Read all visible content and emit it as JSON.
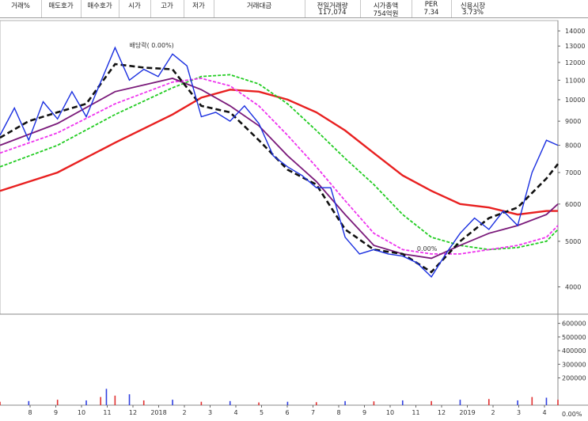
{
  "header": {
    "columns": [
      {
        "label": "거래%",
        "value": ""
      },
      {
        "label": "매도호가",
        "value": ""
      },
      {
        "label": "매수호가",
        "value": ""
      },
      {
        "label": "시가",
        "value": ""
      },
      {
        "label": "고가",
        "value": ""
      },
      {
        "label": "저가",
        "value": ""
      },
      {
        "label": "거래대금",
        "value": ""
      },
      {
        "label": "전일거래량",
        "value": "117,074"
      },
      {
        "label": "시가총액",
        "value": "754억원"
      },
      {
        "label": "PER",
        "value": "7.34"
      },
      {
        "label": "신용시장",
        "value": "3.73%"
      }
    ]
  },
  "chart_data": {
    "type": "line",
    "price_axis": {
      "ticks": [
        4000,
        5000,
        6000,
        7000,
        8000,
        9000,
        10000,
        11000,
        12000,
        13000,
        14000
      ],
      "ylim": [
        3500,
        14500
      ],
      "scale": "log"
    },
    "volume_axis": {
      "ticks": [
        200000,
        300000,
        400000,
        500000,
        600000
      ],
      "ylim": [
        0,
        650000
      ]
    },
    "x_ticks": [
      "8",
      "9",
      "10",
      "11",
      "12",
      "2018",
      "2",
      "3",
      "4",
      "5",
      "6",
      "7",
      "8",
      "9",
      "10",
      "11",
      "12",
      "2019",
      "2",
      "3",
      "4"
    ],
    "price_path": [
      [
        0,
        8400
      ],
      [
        5,
        9600
      ],
      [
        10,
        8200
      ],
      [
        15,
        9900
      ],
      [
        20,
        9100
      ],
      [
        25,
        10400
      ],
      [
        30,
        9200
      ],
      [
        35,
        10900
      ],
      [
        40,
        12900
      ],
      [
        45,
        11000
      ],
      [
        50,
        11600
      ],
      [
        55,
        11200
      ],
      [
        60,
        12500
      ],
      [
        65,
        11800
      ],
      [
        70,
        9200
      ],
      [
        75,
        9400
      ],
      [
        80,
        9000
      ],
      [
        85,
        9700
      ],
      [
        90,
        8900
      ],
      [
        95,
        7600
      ],
      [
        100,
        7200
      ],
      [
        105,
        6900
      ],
      [
        110,
        6500
      ],
      [
        115,
        6500
      ],
      [
        120,
        5100
      ],
      [
        125,
        4700
      ],
      [
        130,
        4800
      ],
      [
        135,
        4700
      ],
      [
        140,
        4650
      ],
      [
        145,
        4500
      ],
      [
        150,
        4200
      ],
      [
        155,
        4700
      ],
      [
        160,
        5200
      ],
      [
        165,
        5600
      ],
      [
        170,
        5300
      ],
      [
        175,
        5800
      ],
      [
        180,
        5400
      ],
      [
        185,
        7000
      ],
      [
        190,
        8200
      ],
      [
        194,
        8000
      ]
    ],
    "series": [
      {
        "color": "#e82020",
        "values": [
          [
            0,
            6400
          ],
          [
            20,
            7000
          ],
          [
            40,
            8100
          ],
          [
            60,
            9300
          ],
          [
            70,
            10100
          ],
          [
            80,
            10500
          ],
          [
            90,
            10400
          ],
          [
            100,
            10000
          ],
          [
            110,
            9400
          ],
          [
            120,
            8600
          ],
          [
            130,
            7700
          ],
          [
            140,
            6900
          ],
          [
            150,
            6400
          ],
          [
            160,
            6000
          ],
          [
            170,
            5900
          ],
          [
            180,
            5700
          ],
          [
            190,
            5800
          ],
          [
            194,
            5800
          ]
        ]
      },
      {
        "color": "#22cc22",
        "values": [
          [
            0,
            7200
          ],
          [
            20,
            8000
          ],
          [
            40,
            9300
          ],
          [
            60,
            10600
          ],
          [
            70,
            11200
          ],
          [
            80,
            11300
          ],
          [
            90,
            10800
          ],
          [
            100,
            9800
          ],
          [
            110,
            8600
          ],
          [
            120,
            7500
          ],
          [
            130,
            6600
          ],
          [
            140,
            5700
          ],
          [
            150,
            5100
          ],
          [
            160,
            4900
          ],
          [
            170,
            4800
          ],
          [
            180,
            4850
          ],
          [
            190,
            5000
          ],
          [
            194,
            5300
          ]
        ]
      },
      {
        "color": "#ee33ee",
        "values": [
          [
            0,
            7700
          ],
          [
            20,
            8500
          ],
          [
            40,
            9800
          ],
          [
            60,
            10900
          ],
          [
            70,
            11100
          ],
          [
            80,
            10700
          ],
          [
            90,
            9700
          ],
          [
            100,
            8400
          ],
          [
            110,
            7200
          ],
          [
            120,
            6100
          ],
          [
            130,
            5200
          ],
          [
            140,
            4800
          ],
          [
            150,
            4700
          ],
          [
            160,
            4700
          ],
          [
            170,
            4800
          ],
          [
            180,
            4900
          ],
          [
            190,
            5100
          ],
          [
            194,
            5400
          ]
        ]
      },
      {
        "color": "#7a1a7a",
        "values": [
          [
            0,
            8000
          ],
          [
            20,
            8900
          ],
          [
            40,
            10400
          ],
          [
            60,
            11100
          ],
          [
            70,
            10500
          ],
          [
            80,
            9700
          ],
          [
            90,
            8800
          ],
          [
            100,
            7600
          ],
          [
            110,
            6700
          ],
          [
            120,
            5700
          ],
          [
            130,
            4900
          ],
          [
            140,
            4700
          ],
          [
            150,
            4600
          ],
          [
            160,
            4900
          ],
          [
            170,
            5200
          ],
          [
            180,
            5400
          ],
          [
            190,
            5700
          ],
          [
            194,
            6000
          ]
        ]
      },
      {
        "color": "#111111",
        "dashed": true,
        "values": [
          [
            0,
            8300
          ],
          [
            10,
            9000
          ],
          [
            20,
            9400
          ],
          [
            30,
            9800
          ],
          [
            40,
            11900
          ],
          [
            50,
            11700
          ],
          [
            60,
            11600
          ],
          [
            70,
            9700
          ],
          [
            80,
            9400
          ],
          [
            90,
            8200
          ],
          [
            100,
            7100
          ],
          [
            110,
            6600
          ],
          [
            120,
            5300
          ],
          [
            130,
            4800
          ],
          [
            140,
            4700
          ],
          [
            150,
            4300
          ],
          [
            160,
            5000
          ],
          [
            170,
            5600
          ],
          [
            180,
            5900
          ],
          [
            190,
            6800
          ],
          [
            194,
            7300
          ]
        ]
      }
    ],
    "volume": [
      [
        0,
        25000
      ],
      [
        10,
        30000
      ],
      [
        20,
        40000
      ],
      [
        30,
        35000
      ],
      [
        35,
        60000
      ],
      [
        37,
        120000
      ],
      [
        40,
        70000
      ],
      [
        45,
        80000
      ],
      [
        50,
        35000
      ],
      [
        60,
        40000
      ],
      [
        70,
        25000
      ],
      [
        80,
        30000
      ],
      [
        90,
        20000
      ],
      [
        100,
        25000
      ],
      [
        110,
        22000
      ],
      [
        120,
        30000
      ],
      [
        130,
        28000
      ],
      [
        140,
        35000
      ],
      [
        150,
        30000
      ],
      [
        160,
        40000
      ],
      [
        170,
        45000
      ],
      [
        180,
        35000
      ],
      [
        185,
        60000
      ],
      [
        190,
        55000
      ],
      [
        194,
        40000
      ]
    ],
    "annotations": [
      {
        "text": "배당락( 0.00%)",
        "at": [
          45,
          12700
        ]
      },
      {
        "text": "0.00%",
        "at": [
          145,
          4700
        ]
      },
      {
        "text": "0.00%",
        "panel": "volume"
      }
    ]
  }
}
